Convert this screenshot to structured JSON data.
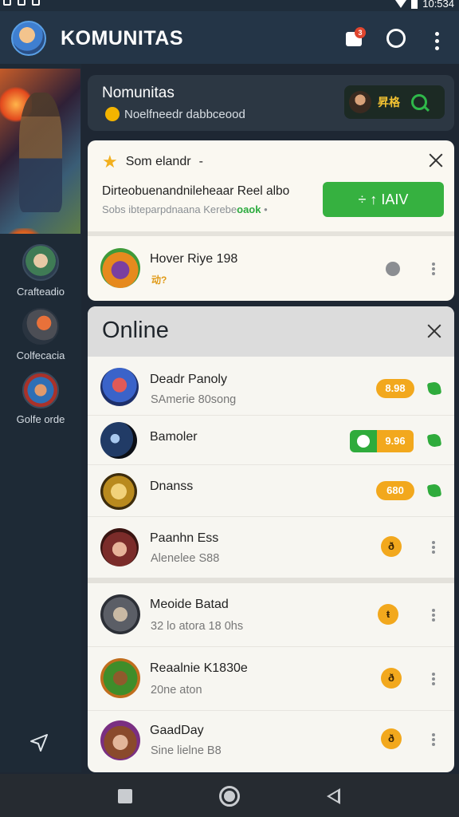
{
  "app": {
    "title": "KOMUNITAS",
    "inbox_badge": "3",
    "status_time": "10:534"
  },
  "sidebar": {
    "items": [
      {
        "label": "Crafteadio",
        "icon": "elf-avatar"
      },
      {
        "label": "Colfecacia",
        "icon": "fox-avatar"
      },
      {
        "label": "Golfe orde",
        "icon": "pirate-avatar"
      }
    ]
  },
  "community": {
    "title": "Nomunitas",
    "subtitle": "Noelfneedr dabbceood",
    "pill_text": "昇格"
  },
  "notification": {
    "title": "Som elandr",
    "title_suffix": "-",
    "line1": "Dirteobuenandnileheaar Reel albo",
    "line2": "Sobs ibteparpdnaana Kerebe",
    "line2_green": "oaok",
    "line2_tail": "•",
    "button_label": "÷ ↑ IAIV",
    "row": {
      "name": "Hover Riye 198",
      "sub": "动?"
    }
  },
  "online": {
    "title": "Online",
    "friends": [
      {
        "name": "Deadr Panoly",
        "sub": "SAmerie  80song",
        "badge": "8.98",
        "badge_style": "pill",
        "action": "check"
      },
      {
        "name": "Bamoler",
        "sub": "",
        "badge": "9.96",
        "badge_style": "combo",
        "action": "check"
      },
      {
        "name": "Dnanss",
        "sub": "",
        "badge": "680",
        "badge_style": "pill",
        "action": "check"
      },
      {
        "name": "Paanhn Ess",
        "sub": "Alenelee  S88",
        "badge": "ð",
        "badge_style": "round",
        "action": "more"
      },
      {
        "name": "Meoide Batad",
        "sub": "32 lo atora 18 0hs",
        "badge": "ŧ",
        "badge_style": "round",
        "action": "more"
      },
      {
        "name": "Reaalnie K1830e",
        "sub": "20ne aton",
        "badge": "ð",
        "badge_style": "round",
        "action": "more"
      },
      {
        "name": "GaadDay",
        "sub": "Sine lielne  B8",
        "badge": "ð",
        "badge_style": "round",
        "action": "more"
      }
    ]
  },
  "colors": {
    "appbar": "#243547",
    "accent_green": "#36b140",
    "badge_orange": "#f2a81d",
    "panel_bg": "#f7f6f1"
  }
}
